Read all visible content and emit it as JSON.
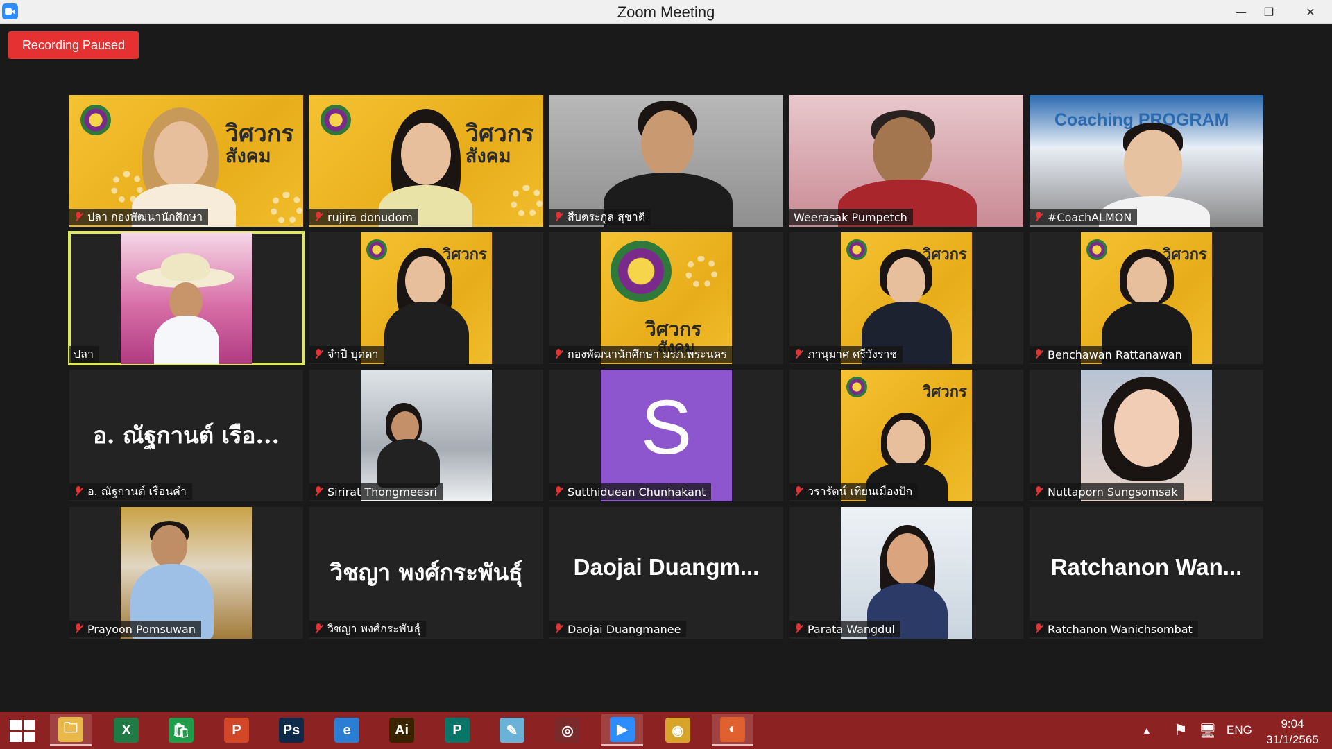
{
  "window": {
    "title": "Zoom Meeting",
    "minimize_glyph": "—",
    "maximize_glyph": "❐",
    "close_glyph": "✕"
  },
  "recording": {
    "label": "Recording Paused",
    "color": "#e53131"
  },
  "participants": [
    {
      "name": "ปลา กองพัฒนานักศึกษา"
    },
    {
      "name": "rujira donudom"
    },
    {
      "name": "สืบตระกูล สุชาติ"
    },
    {
      "name": "Weerasak Pumpetch"
    },
    {
      "name": "#CoachALMON",
      "video_text": "Coaching PROGRAM"
    },
    {
      "name": "ปลา",
      "active_speaker": true
    },
    {
      "name": "จำปี บุดดา"
    },
    {
      "name": "กองพัฒนานักศึกษา มรภ.พระนคร"
    },
    {
      "name": "ภานุมาศ ศรีวังราช"
    },
    {
      "name": "Benchawan Rattanawan"
    },
    {
      "name": "อ. ณัฐกานต์ เรือนคำ",
      "display": "อ. ณัฐกานต์  เรือ..."
    },
    {
      "name": "Sirirat Thongmeesri"
    },
    {
      "name": "Sutthiduean Chunhakant",
      "avatar_letter": "S"
    },
    {
      "name": "วรารัตน์ เทียนเมืองปัก"
    },
    {
      "name": "Nuttaporn Sungsomsak"
    },
    {
      "name": "Prayoon Pomsuwan"
    },
    {
      "name": "วิชญา พงศ์กระพันธุ์",
      "display": "วิชญา  พงศ์กระพันธุ์"
    },
    {
      "name": "Daojai Duangmanee",
      "display": "Daojai  Duangm..."
    },
    {
      "name": "Parata Wangdul"
    },
    {
      "name": "Ratchanon Wanichsombat",
      "display": "Ratchanon  Wan..."
    }
  ],
  "banner_text": {
    "line1": "วิศวกร",
    "line2": "สังคม"
  },
  "taskbar": {
    "apps": [
      {
        "name": "file-explorer",
        "glyph": "🗀",
        "color": "#e8b84a"
      },
      {
        "name": "excel",
        "glyph": "X",
        "color": "#1f7a45"
      },
      {
        "name": "store",
        "glyph": "🛍",
        "color": "#1f9d4a"
      },
      {
        "name": "powerpoint",
        "glyph": "P",
        "color": "#d24726"
      },
      {
        "name": "photoshop",
        "glyph": "Ps",
        "color": "#0d2a4a"
      },
      {
        "name": "internet-explorer",
        "glyph": "e",
        "color": "#2a7fd4"
      },
      {
        "name": "illustrator",
        "glyph": "Ai",
        "color": "#3a2400"
      },
      {
        "name": "publisher",
        "glyph": "P",
        "color": "#077568"
      },
      {
        "name": "notes",
        "glyph": "✎",
        "color": "#6ab2d6"
      },
      {
        "name": "photoscape",
        "glyph": "◎",
        "color": "#7a2a2a"
      },
      {
        "name": "zoom",
        "glyph": "▶",
        "color": "#2d8cff"
      },
      {
        "name": "chrome",
        "glyph": "◉",
        "color": "#d8a42a"
      },
      {
        "name": "slides",
        "glyph": "◐",
        "color": "#e06030"
      }
    ],
    "tray": {
      "language": "ENG",
      "time": "9:04",
      "date": "31/1/2565",
      "up_glyph": "▲",
      "flag_glyph": "⚑",
      "net_glyph": "🖥"
    }
  }
}
